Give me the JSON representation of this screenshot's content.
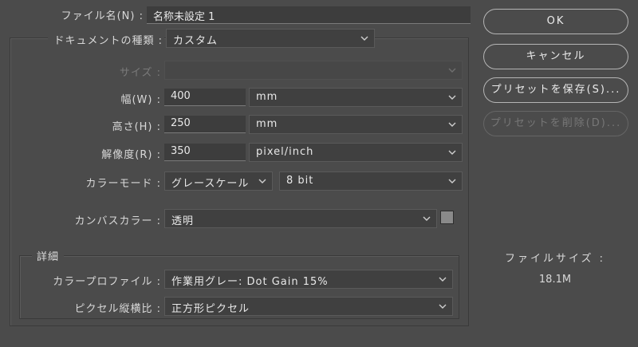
{
  "name": {
    "label": "ファイル名(N) :",
    "value": "名称未設定 1"
  },
  "doc_type": {
    "label": "ドキュメントの種類 :",
    "value": "カスタム"
  },
  "size": {
    "label": "サイズ :",
    "value": ""
  },
  "width": {
    "label": "幅(W) :",
    "value": "400",
    "unit": "mm"
  },
  "height": {
    "label": "高さ(H) :",
    "value": "250",
    "unit": "mm"
  },
  "resolution": {
    "label": "解像度(R) :",
    "value": "350",
    "unit": "pixel/inch"
  },
  "color_mode": {
    "label": "カラーモード :",
    "mode": "グレースケール",
    "depth": "8 bit"
  },
  "canvas_color": {
    "label": "カンバスカラー :",
    "value": "透明",
    "swatch": "#8a8a8a"
  },
  "advanced": {
    "legend": "詳細",
    "profile": {
      "label": "カラープロファイル :",
      "value": "作業用グレー: Dot Gain 15%"
    },
    "pixel_aspect": {
      "label": "ピクセル縦横比 :",
      "value": "正方形ピクセル"
    }
  },
  "buttons": {
    "ok": "OK",
    "cancel": "キャンセル",
    "save_preset": "プリセットを保存(S)...",
    "delete_preset": "プリセットを削除(D)..."
  },
  "filesize": {
    "label": "ファイルサイズ :",
    "value": "18.1M"
  },
  "colors": {
    "bg": "#4b4b4b",
    "field": "#3d3d3d",
    "text": "#d6d6d6"
  }
}
